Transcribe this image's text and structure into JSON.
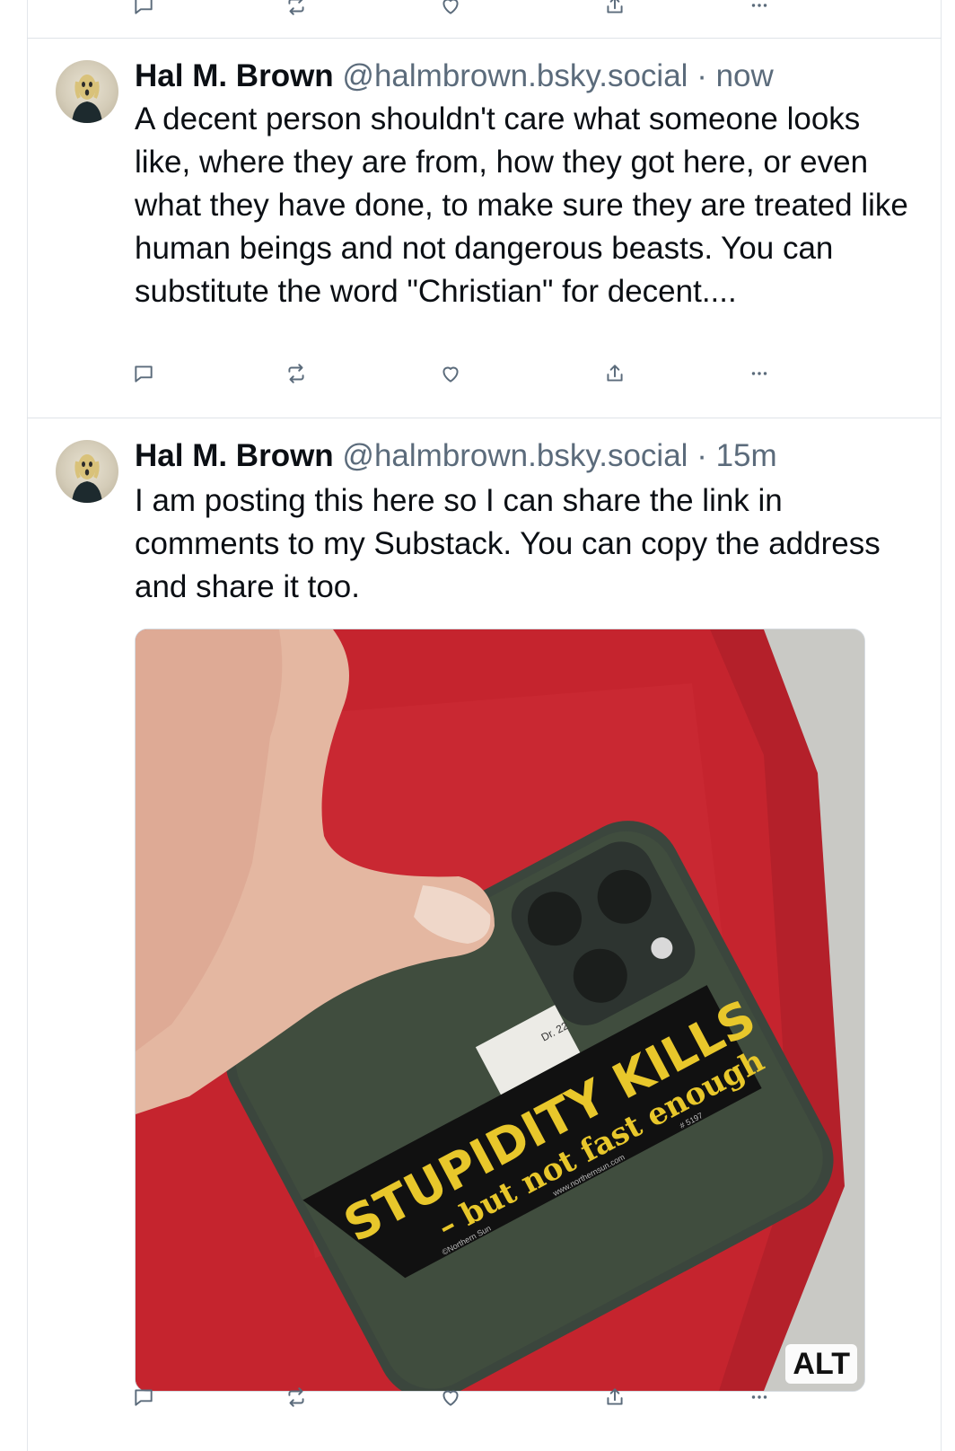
{
  "colors": {
    "icon": "#5b6b7b",
    "text": "#0b0f14",
    "muted": "#5b6b7b",
    "divider": "#dfe3e8"
  },
  "icons": {
    "reply": "speech-bubble-icon",
    "repost": "repost-arrows-icon",
    "like": "heart-icon",
    "share": "share-upload-icon",
    "more": "ellipsis-icon"
  },
  "posts": [
    {
      "author": "Hal M. Brown",
      "handle": "@halmbrown.bsky.social",
      "separator": "·",
      "time": "now",
      "text": "A decent person shouldn't care what someone looks like, where they are from, how they got here, or even what they have done, to make sure they are treated like human beings and not dangerous beasts. You can substitute the word \"Christian\" for decent...."
    },
    {
      "author": "Hal M. Brown",
      "handle": "@halmbrown.bsky.social",
      "separator": "·",
      "time": "15m",
      "text": "I am posting this here so I can share the link in comments to my Substack. You can copy the address and share it too.",
      "image": {
        "alt_label": "ALT",
        "sticker_line1": "STUPIDITY KILLS",
        "sticker_line2": "– but not fast enough",
        "sticker_small_left": "©Northern Sun",
        "sticker_small_mid": "www.northernsun.com",
        "sticker_small_right": "# 5197",
        "label_text": "Dr. 22"
      }
    }
  ]
}
